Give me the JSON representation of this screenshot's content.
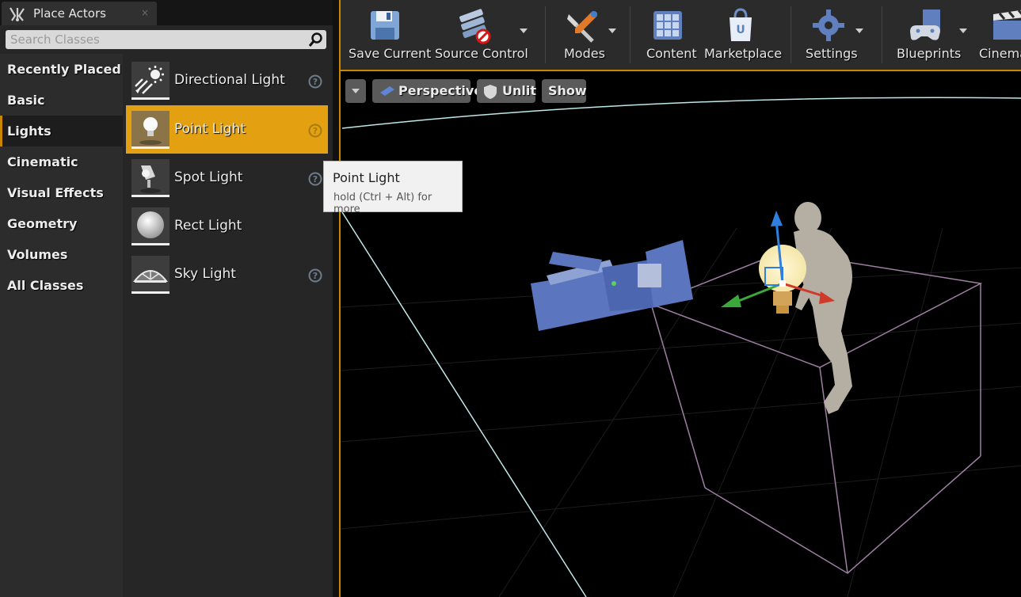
{
  "panel": {
    "tab_title": "Place Actors",
    "tab_close": "×",
    "search_placeholder": "Search Classes",
    "categories": [
      {
        "label": "Recently Placed"
      },
      {
        "label": "Basic"
      },
      {
        "label": "Lights",
        "active": true
      },
      {
        "label": "Cinematic"
      },
      {
        "label": "Visual Effects"
      },
      {
        "label": "Geometry"
      },
      {
        "label": "Volumes"
      },
      {
        "label": "All Classes"
      }
    ],
    "items": [
      {
        "label": "Directional Light",
        "icon": "directional-light-icon",
        "has_help": true
      },
      {
        "label": "Point Light",
        "icon": "point-light-icon",
        "has_help": true,
        "selected": true
      },
      {
        "label": "Spot Light",
        "icon": "spot-light-icon",
        "has_help": true
      },
      {
        "label": "Rect Light",
        "icon": "rect-light-icon",
        "has_help": false
      },
      {
        "label": "Sky Light",
        "icon": "sky-light-icon",
        "has_help": true
      }
    ]
  },
  "tooltip": {
    "title": "Point Light",
    "hint": "hold (Ctrl + Alt) for more"
  },
  "toolbar": {
    "buttons": [
      {
        "label": "Save Current",
        "icon": "save-icon",
        "dropdown": false
      },
      {
        "label": "Source Control",
        "icon": "source-control-icon",
        "dropdown": true
      },
      {
        "label": "Modes",
        "icon": "modes-icon",
        "dropdown": true
      },
      {
        "label": "Content",
        "icon": "content-icon",
        "dropdown": false
      },
      {
        "label": "Marketplace",
        "icon": "marketplace-icon",
        "dropdown": false
      },
      {
        "label": "Settings",
        "icon": "settings-icon",
        "dropdown": true
      },
      {
        "label": "Blueprints",
        "icon": "blueprints-icon",
        "dropdown": true
      },
      {
        "label": "Cinematics",
        "icon": "cinematics-icon",
        "dropdown": false
      }
    ]
  },
  "viewport": {
    "view_mode": "Perspective",
    "lighting_mode": "Unlit",
    "show_label": "Show"
  },
  "colors": {
    "accent": "#e3a010",
    "selection": "#e3a010",
    "panel_bg": "#262626",
    "viewport_bg": "#000000"
  }
}
